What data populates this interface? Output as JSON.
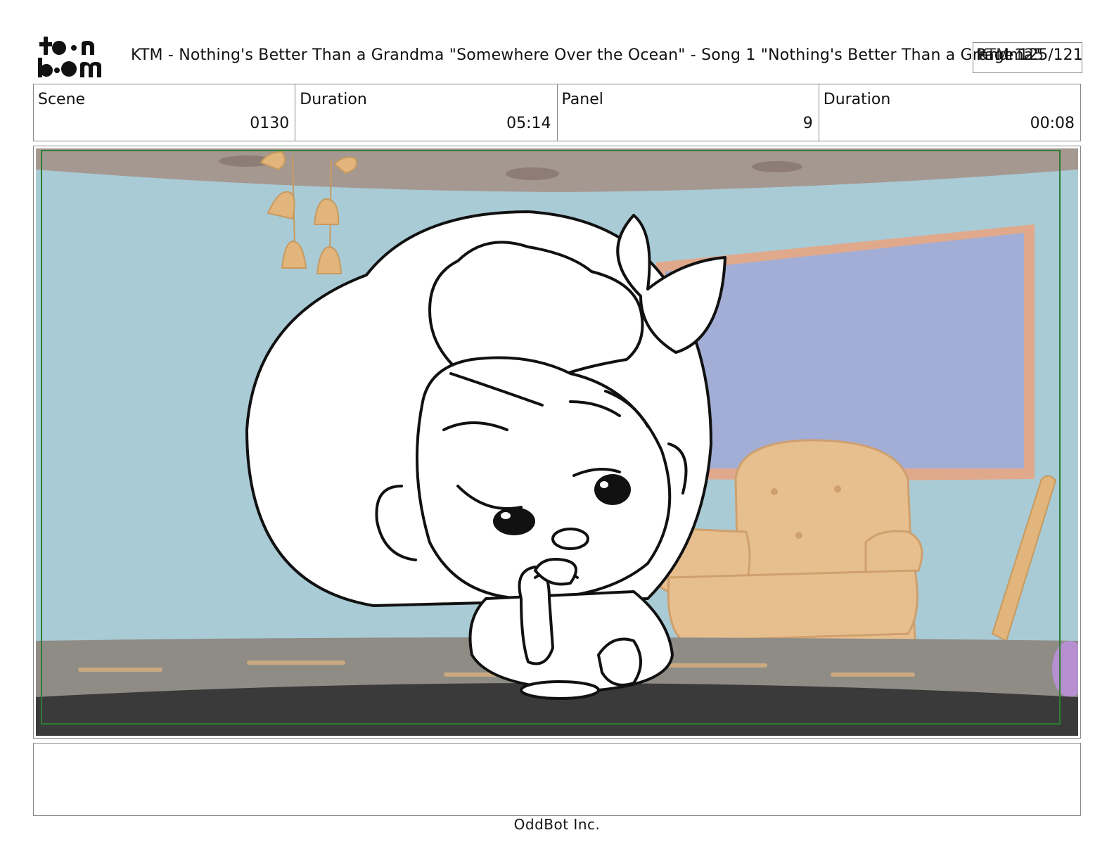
{
  "header": {
    "logo_text": "toonboom",
    "title": "KTM - Nothing's Better Than a Grandma  \"Somewhere Over the Ocean\" - Song 1 \"Nothing's Better Than a Grandma\"",
    "page_number": "Page 125/121",
    "page_prefix": "KTM 125"
  },
  "info": {
    "scene_label": "Scene",
    "scene_value": "0130",
    "scene_duration_label": "Duration",
    "scene_duration_value": "05:14",
    "panel_label": "Panel",
    "panel_value": "9",
    "panel_duration_label": "Duration",
    "panel_duration_value": "00:08"
  },
  "panel": {
    "image_name": "storyboard-panel-drawing"
  },
  "notes": {
    "text": ""
  },
  "footer": {
    "company": "OddBot Inc."
  }
}
